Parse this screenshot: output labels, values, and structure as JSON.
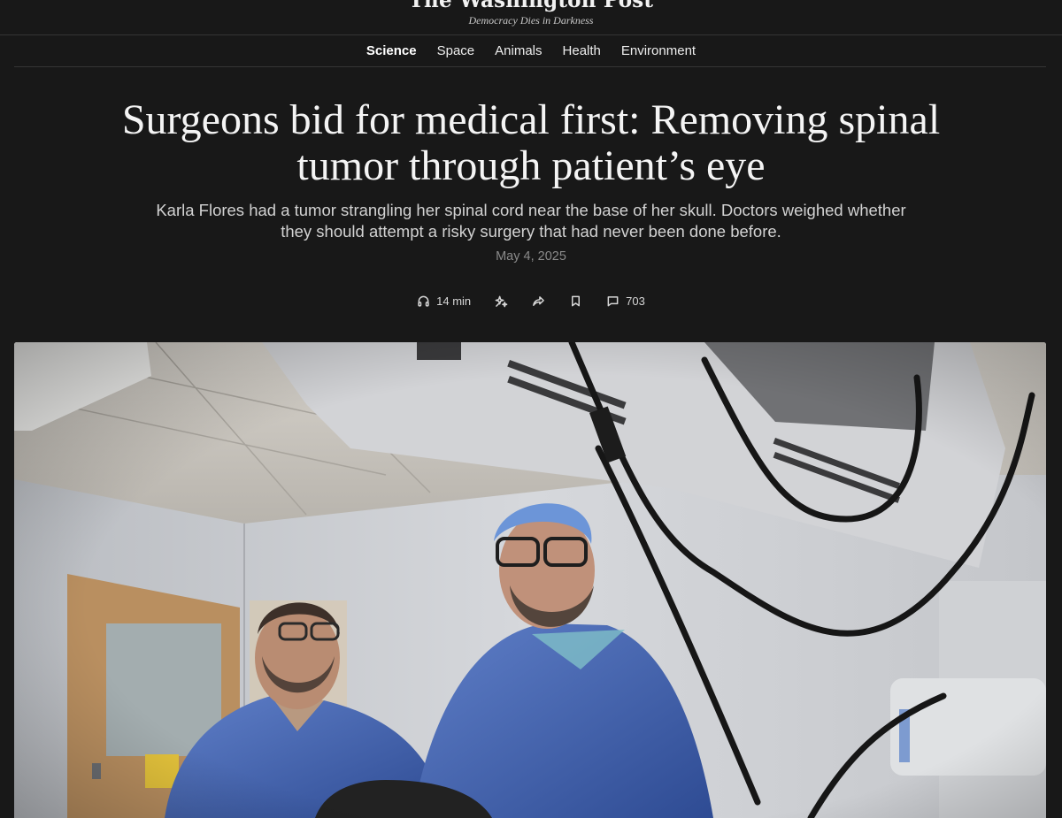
{
  "masthead": {
    "logo": "The Washington Post",
    "tagline": "Democracy Dies in Darkness"
  },
  "nav": {
    "items": [
      {
        "label": "Science",
        "active": true
      },
      {
        "label": "Space",
        "active": false
      },
      {
        "label": "Animals",
        "active": false
      },
      {
        "label": "Health",
        "active": false
      },
      {
        "label": "Environment",
        "active": false
      }
    ]
  },
  "article": {
    "headline": "Surgeons bid for medical first: Removing spinal tumor through patient’s eye",
    "dek": "Karla Flores had a tumor strangling her spinal cord near the base of her skull. Doctors weighed whether they should attempt a risky surgery that had never been done before.",
    "date": "May 4, 2025"
  },
  "toolbar": {
    "listen_label": "14 min",
    "comments_count": "703",
    "icons": [
      "headphones-icon",
      "sparkle-icon",
      "share-icon",
      "bookmark-icon",
      "comment-icon"
    ]
  },
  "colors": {
    "background": "#181818",
    "text": "#ececec",
    "muted": "#8a8a8a",
    "scrub_blue": "#3f5fa8"
  }
}
